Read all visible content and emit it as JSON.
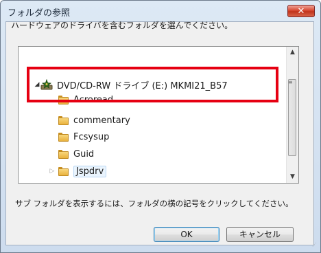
{
  "window": {
    "title": "フォルダの参照",
    "close_label": "✕"
  },
  "description": "ハードウェアのドライバを含むフォルダを選んでください。",
  "tree": {
    "drive": {
      "label": "DVD/CD-RW ドライブ (E:) MKMI21_B57",
      "expanded": true,
      "icon": "drive-icon"
    },
    "folders": [
      {
        "label": "Acroread",
        "icon": "folder-icon"
      },
      {
        "label": "commentary",
        "icon": "folder-icon"
      },
      {
        "label": "Fcsysup",
        "icon": "folder-icon"
      },
      {
        "label": "Guid",
        "icon": "folder-icon"
      },
      {
        "label": "Jspdrv",
        "icon": "folder-icon",
        "has_children": true
      }
    ]
  },
  "hint": "サブ フォルダを表示するには、フォルダの横の記号をクリックしてください。",
  "buttons": {
    "ok": "OK",
    "cancel": "キャンセル"
  },
  "colors": {
    "highlight_box": "#e60012",
    "close_button": "#d84a33"
  }
}
